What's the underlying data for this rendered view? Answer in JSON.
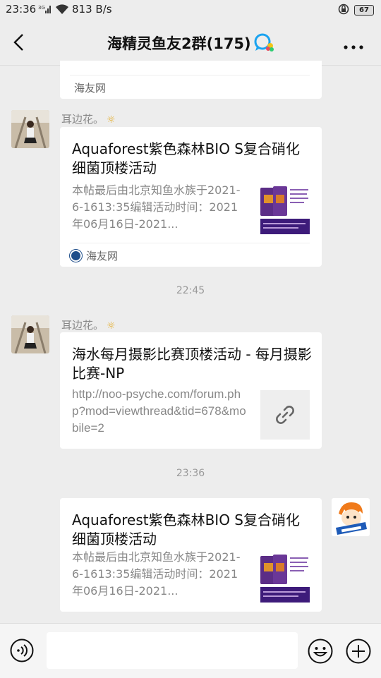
{
  "status": {
    "time": "23:36",
    "network": "3G",
    "speed": "813 B/s",
    "battery": "67"
  },
  "header": {
    "title": "海精灵鱼友2群(175)"
  },
  "messages": [
    {
      "source": "海友网"
    },
    {
      "sender": "耳边花。",
      "title": "Aquaforest紫色森林BIO S复合硝化细菌顶楼活动",
      "desc": "本帖最后由北京知鱼水族于2021-6-1613:35编辑活动时间：2021年06月16日-2021...",
      "source": "海友网"
    },
    {
      "time": "22:45"
    },
    {
      "sender": "耳边花。",
      "title": "海水每月摄影比赛顶楼活动 - 每月摄影比赛-NP",
      "desc": "http://noo-psyche.com/forum.php?mod=viewthread&tid=678&mobile=2"
    },
    {
      "time": "23:36"
    },
    {
      "title": "Aquaforest紫色森林BIO S复合硝化细菌顶楼活动",
      "desc": "本帖最后由北京知鱼水族于2021-6-1613:35编辑活动时间：2021年06月16日-2021..."
    }
  ],
  "input": {
    "value": ""
  }
}
